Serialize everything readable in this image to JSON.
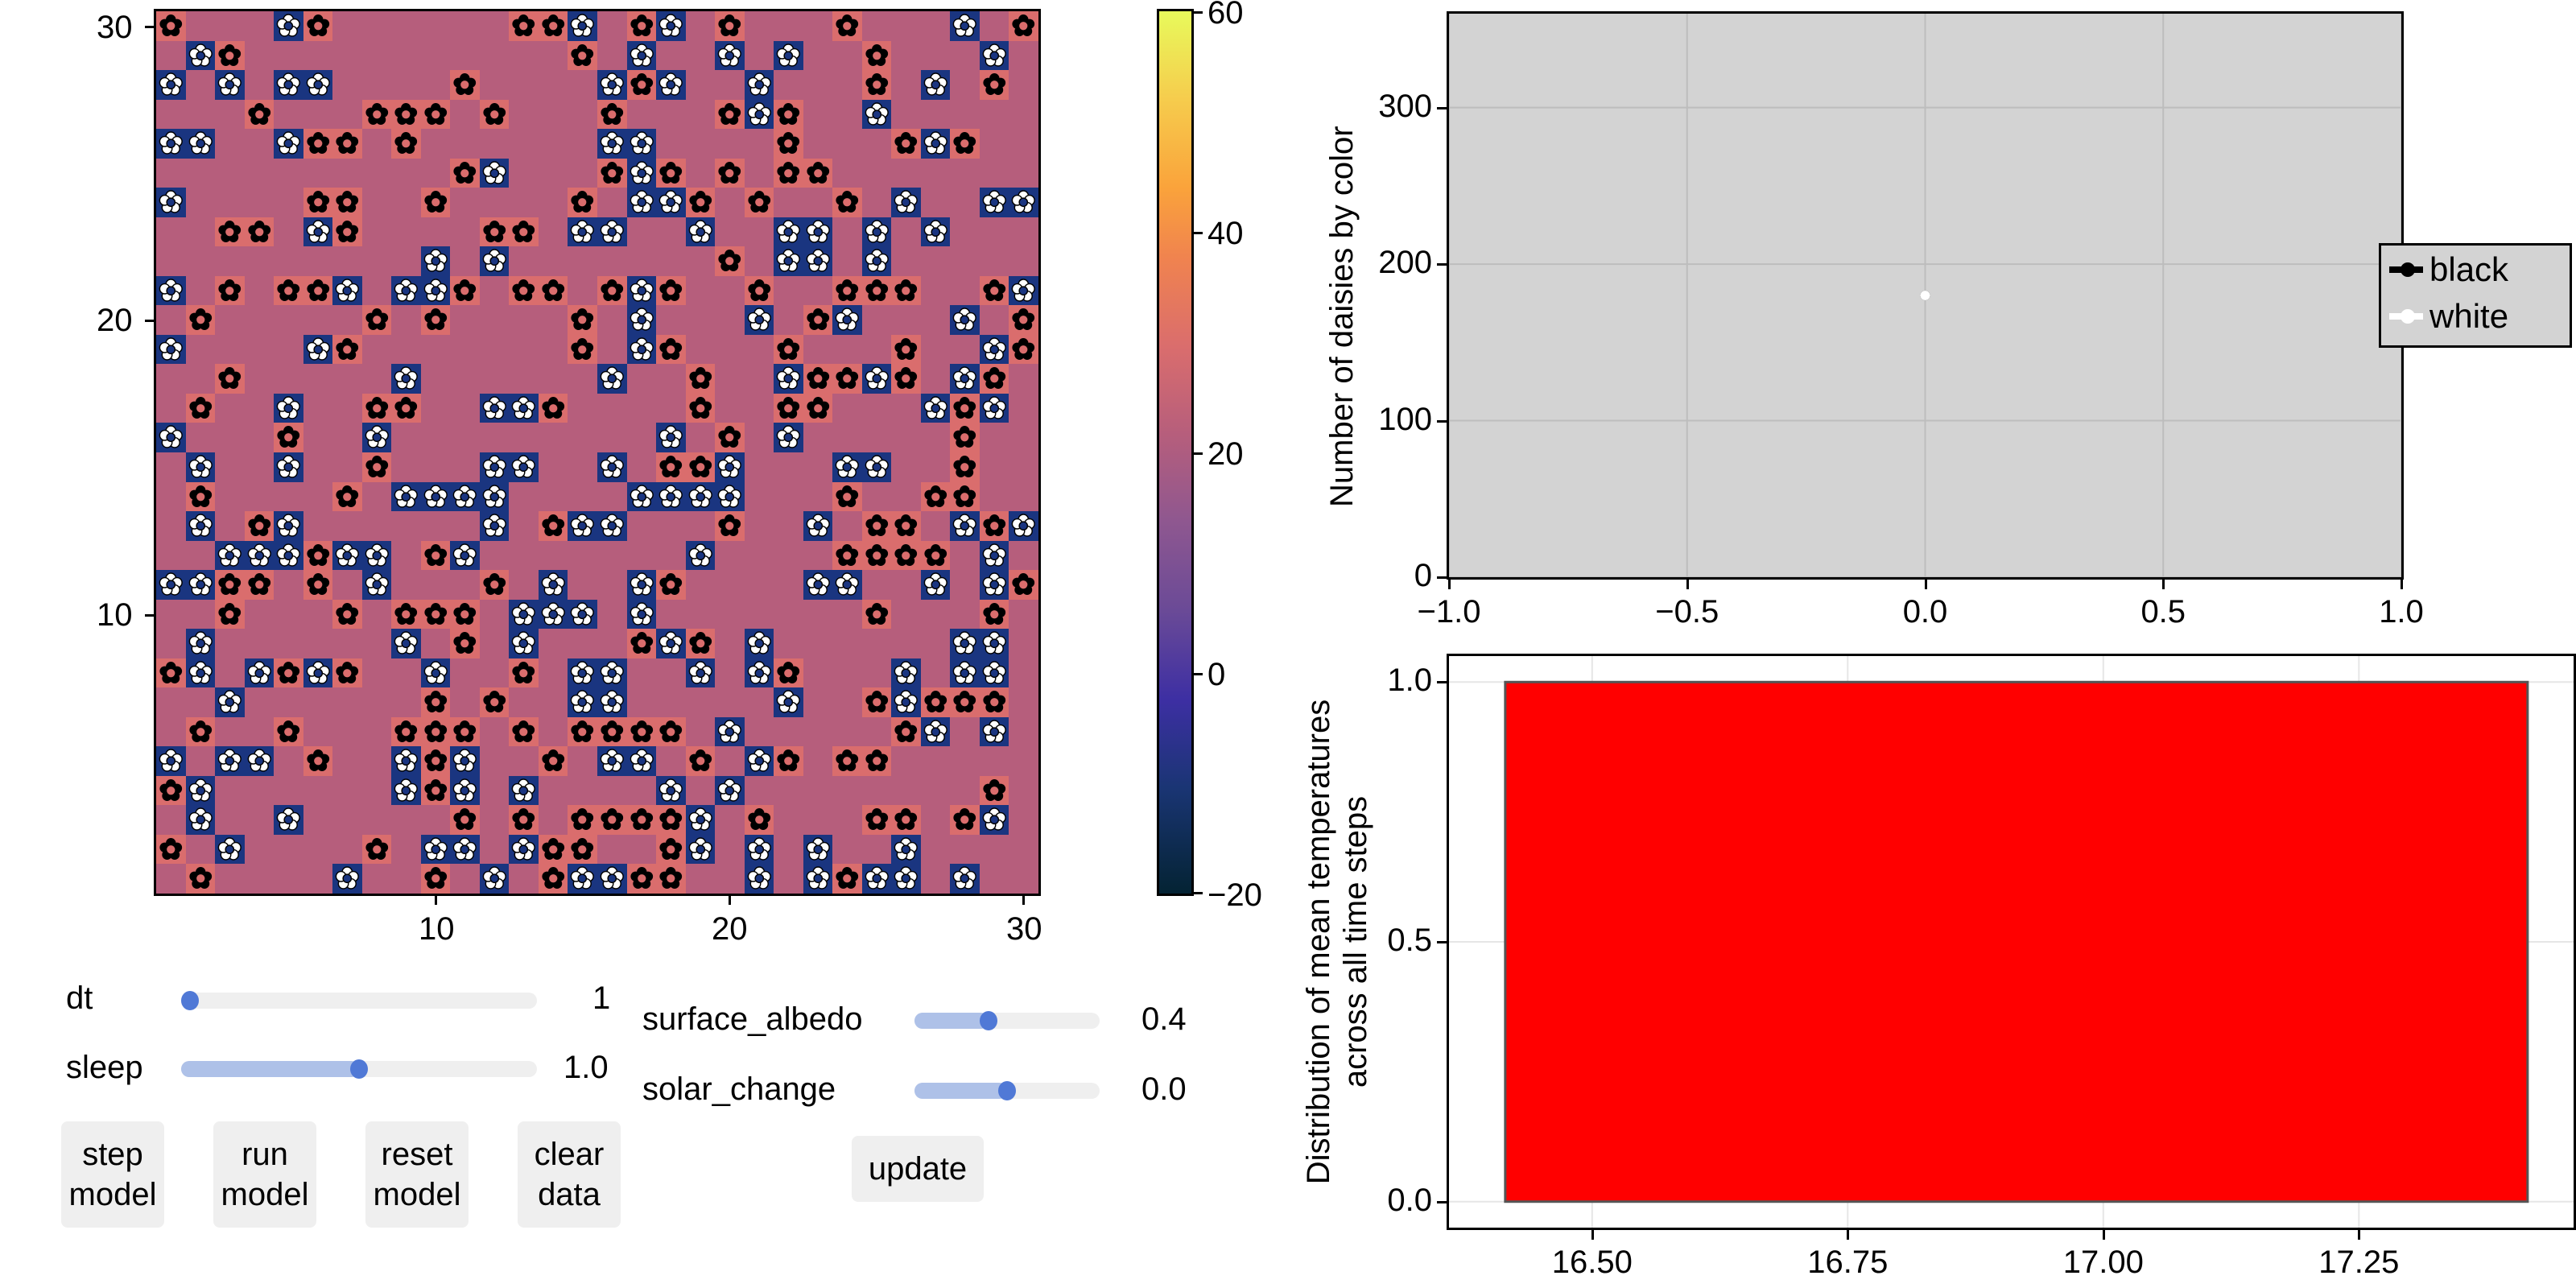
{
  "colors": {
    "ground": "#b65e7c",
    "black_daisy_cell": "#da6d6d",
    "white_daisy_cell": "#1a3580",
    "accent": "#5079d6",
    "accent_light": "#aec1e8",
    "hist_bar": "#ff0000",
    "plot_bg": "#d3d3d3"
  },
  "grid": {
    "size": 30,
    "legend": {
      "B": "black daisy",
      "W": "white daisy",
      ".": "empty"
    },
    "rows_top_to_bottom": [
      "B...WB......BBW.BW.B...B...W.B",
      ".WB...........B.W..W.W..B...W.",
      "W.W.WW....B....WBW..W...B.W.B.",
      "...B...BBB.B...B...BWB..W.....",
      "WW..WBB.B......WW....B...BWB..",
      "..........BW...BWB.B.BB.......",
      "W....BB..B....B.WWB.B..B.W..WW",
      "..BB.WB....BB.WW..W..WW.W.W...",
      ".........W.W.......B.WW.W.....",
      "W.B.BBW.WWB.BB.BWB..B..BBB..BW",
      ".B.....B.B....B.W...W.BW...W.B",
      "W....WB.......B.WB...B...B..WB",
      "..B.....W......W..B..WBBWB.WB.",
      ".B..W..BB..WWB....B..BB...WBW.",
      "W...B..W.........W.B.W.....B..",
      ".W..W..B...WW..W.BBW...WW..B..",
      ".B....B.WWWW....WWWW...B..BB..",
      ".W.BW......W.BWW...B..W.BB.WBW",
      "..WWWBWW.BW.......W....BBBB.W.",
      "WWBB.B.W...B.W..WB....WW..W.WB",
      "..B...B.BBB.WWW.W.......B...B.",
      ".W......W.B.W...BWB.W......WW.",
      "BW.WBWB..W..B.WW..W.WB...W.WW.",
      "..W......B.B..WW.....W..BWBBB.",
      ".B..B...BBB.B.BBBB.W.....BW.W.",
      "W.WW.B..WBW..B.WW.B.WB.BB.....",
      "BW......WBW.W....W.W........B.",
      ".W..W.....B.B.BBBBW.B...BB.BW.",
      "B.W....B.WW.WBB..BW.W.W..W....",
      ".B....W..B.W.BWWBB..W.WBWW.W.."
    ],
    "x_ticks": [
      "10",
      "20",
      "30"
    ],
    "y_ticks": [
      "10",
      "20",
      "30"
    ]
  },
  "colorbar": {
    "ticks": [
      "60",
      "40",
      "20",
      "0",
      "−20"
    ],
    "range": [
      -20,
      60
    ],
    "colormap": "thermal"
  },
  "chart_data": [
    {
      "type": "scatter",
      "title": "",
      "xlabel": "",
      "ylabel": "Number of daisies by color",
      "xlim": [
        -1.0,
        1.0
      ],
      "ylim": [
        0,
        360
      ],
      "x_ticks": [
        "−1.0",
        "−0.5",
        "0.0",
        "0.5",
        "1.0"
      ],
      "y_ticks": [
        "0",
        "100",
        "200",
        "300"
      ],
      "grid": true,
      "legend_position": "right",
      "series": [
        {
          "name": "black",
          "color": "#000000",
          "x": [
            0
          ],
          "y": [
            180
          ]
        },
        {
          "name": "white",
          "color": "#ffffff",
          "x": [
            0
          ],
          "y": [
            180
          ]
        }
      ]
    },
    {
      "type": "bar",
      "title": "",
      "xlabel": "",
      "ylabel": "Distribution of mean temperatures\nacross all time steps",
      "xlim": [
        16.36,
        17.46
      ],
      "ylim": [
        -0.05,
        1.05
      ],
      "x_ticks": [
        "16.50",
        "16.75",
        "17.00",
        "17.25"
      ],
      "y_ticks": [
        "0.0",
        "0.5",
        "1.0"
      ],
      "grid": true,
      "bins": [
        {
          "x_start": 16.415,
          "x_end": 17.415,
          "value": 1.0
        }
      ]
    }
  ],
  "controls": {
    "sliders": [
      {
        "label": "dt",
        "value_text": "1",
        "fraction": 0.0
      },
      {
        "label": "sleep",
        "value_text": "1.0",
        "fraction": 0.5
      },
      {
        "label": "surface_albedo",
        "value_text": "0.4",
        "fraction": 0.4
      },
      {
        "label": "solar_change",
        "value_text": "0.0",
        "fraction": 0.5
      }
    ],
    "buttons": [
      {
        "label": "step\nmodel"
      },
      {
        "label": "run\nmodel"
      },
      {
        "label": "reset\nmodel"
      },
      {
        "label": "clear\ndata"
      },
      {
        "label": "update"
      }
    ]
  }
}
